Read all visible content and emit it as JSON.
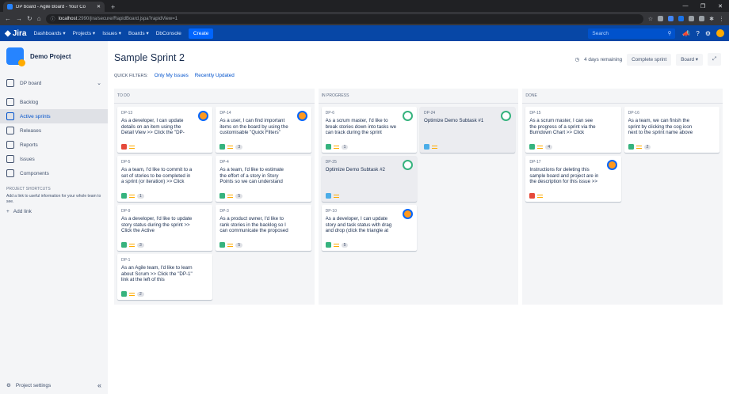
{
  "browser": {
    "tab_title": "DP board - Agile Board - Your Co",
    "new_tab": "+",
    "url_host": "localhost",
    "url_rest": ":2990/jira/secure/RapidBoard.jspa?rapidView=1"
  },
  "jira_nav": {
    "logo": "Jira",
    "items": [
      "Dashboards ▾",
      "Projects ▾",
      "Issues ▾",
      "Boards ▾",
      "DbConsole"
    ],
    "create": "Create",
    "search_placeholder": "Search"
  },
  "sidebar": {
    "project_name": "Demo Project",
    "items": [
      {
        "label": "DP board"
      },
      {
        "label": "Backlog"
      },
      {
        "label": "Active sprints"
      },
      {
        "label": "Releases"
      },
      {
        "label": "Reports"
      },
      {
        "label": "Issues"
      },
      {
        "label": "Components"
      }
    ],
    "shortcuts_heading": "PROJECT SHORTCUTS",
    "shortcuts_desc": "Add a link to useful information for your whole team to see.",
    "add_link": "Add link",
    "project_settings": "Project settings"
  },
  "board": {
    "title": "Sample Sprint 2",
    "remaining": "4 days remaining",
    "complete_sprint": "Complete sprint",
    "board_menu": "Board ▾",
    "quick_filters_label": "QUICK FILTERS:",
    "quick_filters": [
      "Only My Issues",
      "Recently Updated"
    ],
    "columns": [
      "TO DO",
      "IN PROGRESS",
      "DONE"
    ],
    "cards": {
      "dp13": {
        "key": "DP-13",
        "summary": "As a developer, I can update details on an item using the Detail View >> Click the \"DP-"
      },
      "dp14": {
        "key": "DP-14",
        "summary": "As a user, I can find important items on the board by using the customisable \"Quick Filters\"",
        "points": "3"
      },
      "dp5": {
        "key": "DP-5",
        "summary": "As a team, I'd like to commit to a set of stories to be completed in a sprint (or iteration) >> Click",
        "points": "1"
      },
      "dp4": {
        "key": "DP-4",
        "summary": "As a team, I'd like to estimate the effort of a story in Story Points so we can understand",
        "points": "5"
      },
      "dp9": {
        "key": "DP-9",
        "summary": "As a developer, I'd like to update story status during the sprint >> Click the Active",
        "points": "3"
      },
      "dp3": {
        "key": "DP-3",
        "summary": "As a product owner, I'd like to rank stories in the backlog so I can communicate the proposed",
        "points": "5"
      },
      "dp1": {
        "key": "DP-1",
        "summary": "As an Agile team, I'd like to learn about Scrum >> Click the \"DP-1\" link at the left of this",
        "points": "2"
      },
      "dp6": {
        "key": "DP-6",
        "summary": "As a scrum master, I'd like to break stories down into tasks we can track during the sprint",
        "points": "1"
      },
      "dp24": {
        "key": "DP-24",
        "summary": "Optimize Demo Subtask #1"
      },
      "dp25": {
        "key": "DP-25",
        "summary": "Optimize Demo Subtask #2"
      },
      "dp10": {
        "key": "DP-10",
        "summary": "As a developer, I can update story and task status with drag and drop (click the triangle at",
        "points": "5"
      },
      "dp15": {
        "key": "DP-15",
        "summary": "As a scrum master, I can see the progress of a sprint via the Burndown Chart >> Click",
        "points": "4"
      },
      "dp16": {
        "key": "DP-16",
        "summary": "As a team, we can finish the sprint by clicking the cog icon next to the sprint name above",
        "points": "2"
      },
      "dp17": {
        "key": "DP-17",
        "summary": "Instructions for deleting this sample board and project are in the description for this issue >>"
      }
    }
  }
}
